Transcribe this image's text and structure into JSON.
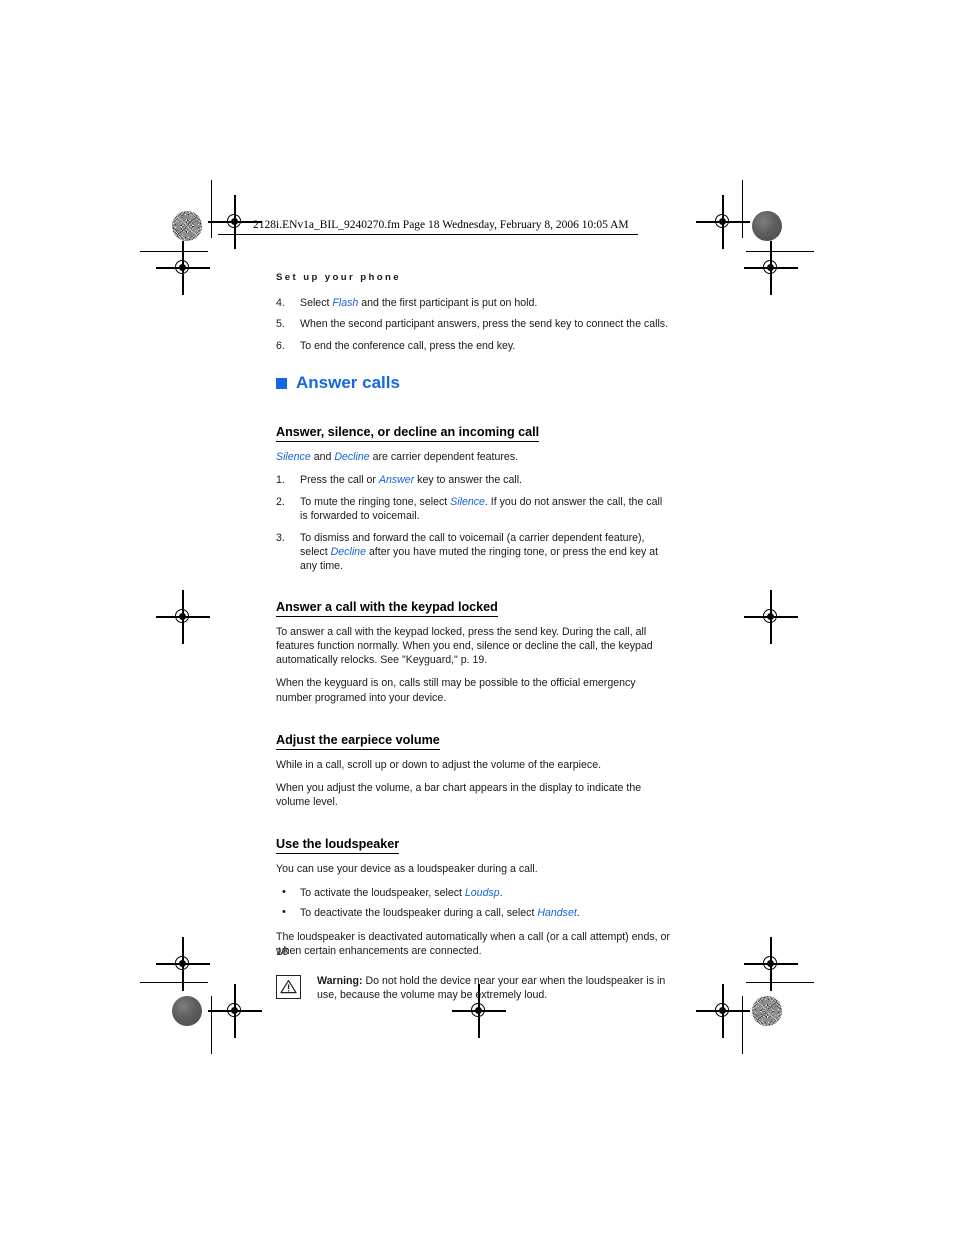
{
  "document": {
    "file_header": "2128i.ENv1a_BIL_9240270.fm  Page 18  Wednesday, February 8, 2006  10:05 AM",
    "running_head": "Set up your phone",
    "page_number": "18",
    "accent_color": "#1568E0",
    "term_color": "#1464D2"
  },
  "steps_continued": [
    {
      "num": "4.",
      "text_before": "Select ",
      "term": "Flash",
      "text_after": " and the first participant is put on hold."
    },
    {
      "num": "5.",
      "text_before": "When the second participant answers, press the send key to connect the calls.",
      "term": "",
      "text_after": ""
    },
    {
      "num": "6.",
      "text_before": "To end the conference call, press the end key.",
      "term": "",
      "text_after": ""
    }
  ],
  "chapter": {
    "title": "Answer calls",
    "bullet_icon": "square-bullet"
  },
  "sections": {
    "answer_silence_decline": {
      "heading": "Answer, silence, or decline an incoming call",
      "intro_pre": "",
      "intro_term1": "Silence",
      "intro_mid": " and ",
      "intro_term2": "Decline",
      "intro_post": " are carrier dependent features.",
      "steps": [
        {
          "num": "1.",
          "pre": "Press the call or ",
          "term": "Answer",
          "post": " key to answer the call."
        },
        {
          "num": "2.",
          "pre": "To mute the ringing tone, select ",
          "term": "Silence",
          "post": ". If you do not answer the call, the call is forwarded to voicemail."
        },
        {
          "num": "3.",
          "pre": "To dismiss and forward the call to voicemail (a carrier dependent feature), select ",
          "term": "Decline",
          "post": " after you have muted the ringing tone, or press the end key at any time."
        }
      ]
    },
    "keypad_locked": {
      "heading": "Answer a call with the keypad locked",
      "paragraphs": [
        "To answer a call with the keypad locked, press the send key. During the call, all features function normally. When you end, silence or decline the call, the keypad automatically relocks. See \"Keyguard,\" p. 19.",
        "When the keyguard is on, calls still may be possible to the official emergency number programed into your device."
      ]
    },
    "earpiece_volume": {
      "heading": "Adjust the earpiece volume",
      "paragraphs": [
        "While in a call, scroll up or down to adjust the volume of the earpiece.",
        "When you adjust the volume, a bar chart appears in the display to indicate the volume level."
      ]
    },
    "loudspeaker": {
      "heading": "Use the loudspeaker",
      "intro": "You can use your device as a loudspeaker during a call.",
      "bullets": [
        {
          "pre": "To activate the loudspeaker, select ",
          "term": "Loudsp",
          "post": "."
        },
        {
          "pre": "To deactivate the loudspeaker during a call, select ",
          "term": "Handset",
          "post": "."
        }
      ],
      "outro": "The loudspeaker is deactivated automatically when a call (or a call attempt) ends, or when certain enhancements are connected."
    }
  },
  "warning": {
    "icon": "warning-triangle-icon",
    "label": "Warning:",
    "text": " Do not hold the device near your ear when the loudspeaker is in use, because the volume may be extremely loud."
  }
}
